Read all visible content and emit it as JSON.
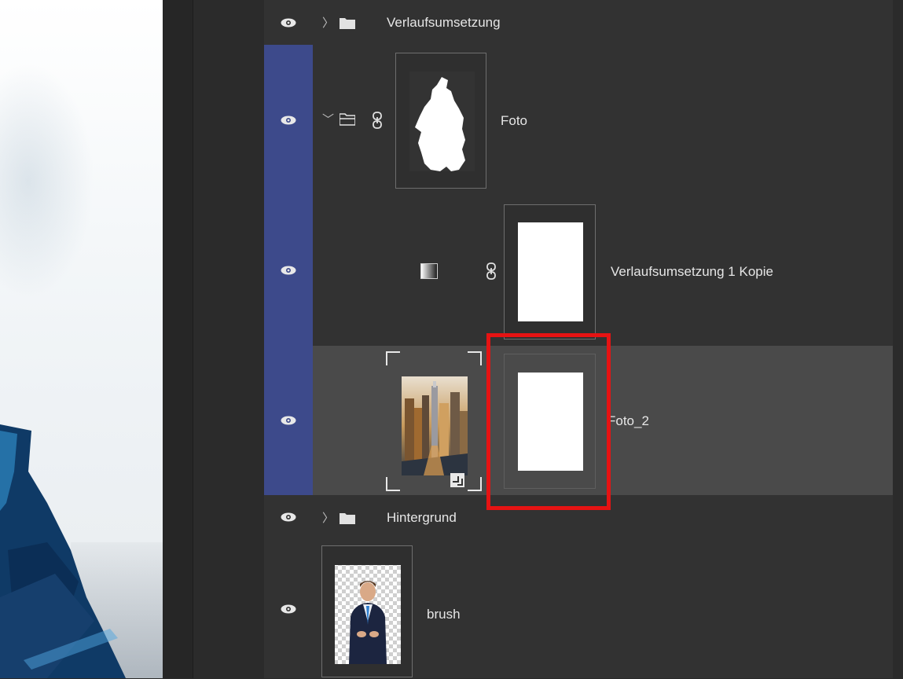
{
  "layers": {
    "group_1": {
      "name": "Verlaufsumsetzung",
      "expanded": false
    },
    "group_2": {
      "name": "Foto",
      "expanded": true,
      "selected": true
    },
    "adjustment": {
      "name": "Verlaufsumsetzung 1 Kopie",
      "selected": true
    },
    "photo_layer": {
      "name": "Foto_2",
      "selected": true,
      "highlighted": true
    },
    "group_3": {
      "name": "Hintergrund",
      "expanded": false
    },
    "brush_layer": {
      "name": "brush"
    }
  },
  "icons": {
    "visibility": "eye-icon",
    "group": "folder-icon",
    "expanded": "chevron-down-icon",
    "collapsed": "chevron-right-icon",
    "link": "link-icon",
    "adjustment": "gradient-map-icon",
    "smart_object": "smart-object-icon"
  },
  "colors": {
    "selection": "#3d4a8b",
    "row_bg": "#323232",
    "row_highlight": "#4a4a4a",
    "annotation": "#e61313"
  }
}
